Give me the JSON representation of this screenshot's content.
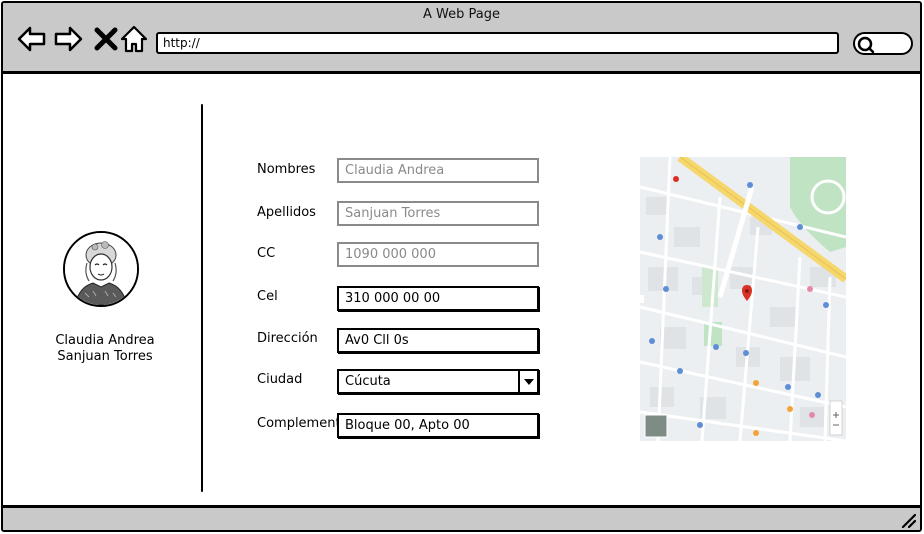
{
  "window": {
    "title": "A Web Page"
  },
  "browser": {
    "url": "http://"
  },
  "profile": {
    "first_name": "Claudia Andrea",
    "last_name": "Sanjuan Torres"
  },
  "form": {
    "fields": [
      {
        "label": "Nombres",
        "value": "Claudia Andrea",
        "editable": false
      },
      {
        "label": "Apellidos",
        "value": "Sanjuan Torres",
        "editable": false
      },
      {
        "label": "CC",
        "value": "1090 000 000",
        "editable": false
      },
      {
        "label": "Cel",
        "value": "310 000 00 00",
        "editable": true
      },
      {
        "label": "Dirección",
        "value": "Av0 Cll 0s",
        "editable": true
      },
      {
        "label": "Ciudad",
        "value": "Cúcuta",
        "editable": true,
        "type": "select"
      },
      {
        "label": "Complement",
        "value": "Bloque 00, Apto 00",
        "editable": true
      }
    ]
  },
  "colors": {
    "chrome": "#c9c9c9",
    "readonly_text": "#8a8a8a",
    "map_road": "#f5d76e",
    "map_park": "#bfe3c3",
    "map_pin": "#d93025"
  },
  "icons": [
    "back-arrow-icon",
    "forward-arrow-icon",
    "close-x-icon",
    "home-icon",
    "search-icon",
    "resize-grip-icon",
    "map-pin-icon"
  ]
}
